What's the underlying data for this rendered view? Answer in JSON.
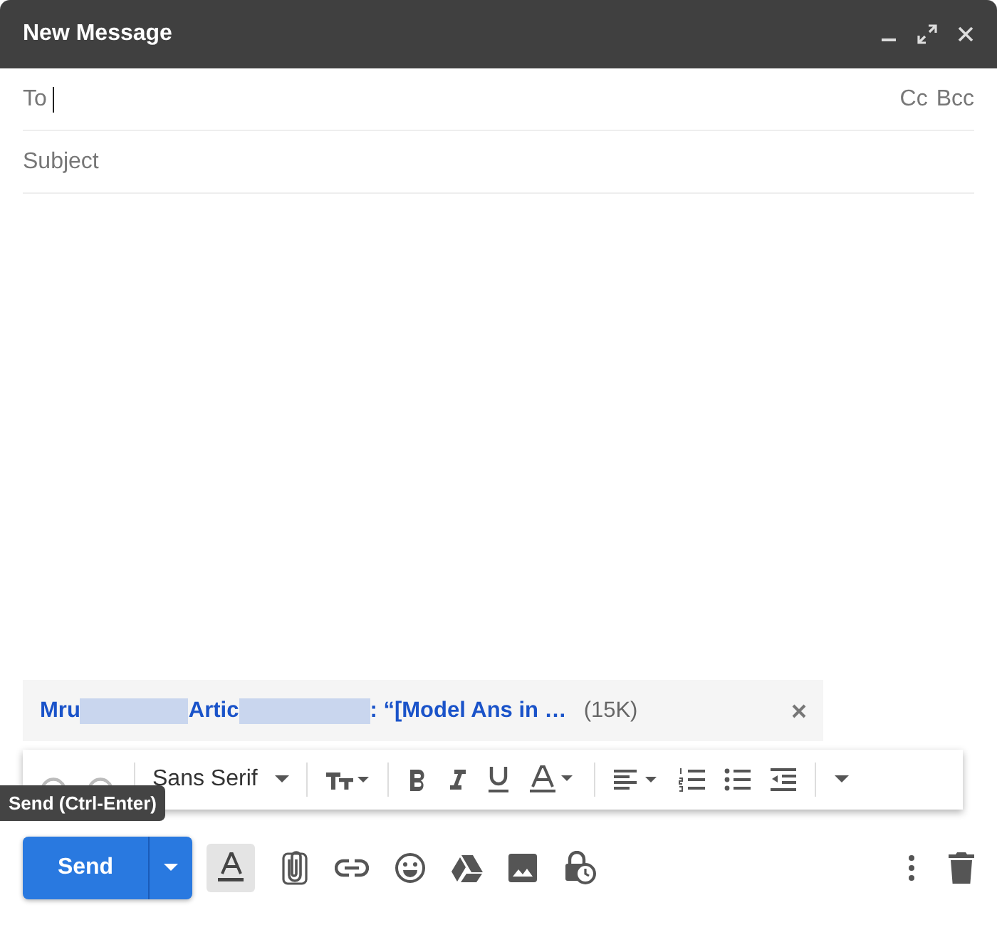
{
  "window": {
    "title": "New Message"
  },
  "to": {
    "label": "To",
    "cc": "Cc",
    "bcc": "Bcc"
  },
  "subject": {
    "placeholder": "Subject"
  },
  "attachment": {
    "name_parts": [
      "Mru",
      "Artic",
      ": “[Model Ans in …"
    ],
    "size": "(15K)"
  },
  "formatting_toolbar": {
    "font": "Sans Serif"
  },
  "tooltip": "Send (Ctrl-Enter)",
  "send_button": {
    "label": "Send"
  },
  "formatting_toggle": {
    "selected": true
  }
}
